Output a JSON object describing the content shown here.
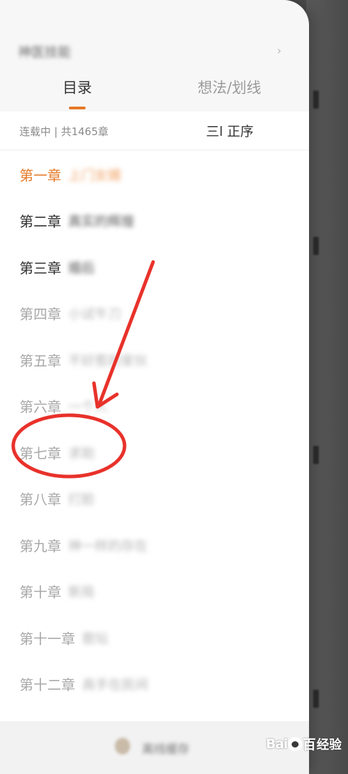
{
  "drawer": {
    "book_title": "神医技能",
    "tabs": [
      {
        "label": "目录",
        "active": true
      },
      {
        "label": "想法/划线",
        "active": false
      }
    ],
    "status_text": "连载中 | 共1465章",
    "sort_icon_glyph": "三l",
    "sort_label": "正序",
    "chapters": [
      {
        "num": "第一章",
        "title": "上门女婿",
        "state": "current"
      },
      {
        "num": "第二章",
        "title": "真实的辉煌",
        "state": "read"
      },
      {
        "num": "第三章",
        "title": "婚后",
        "state": "read"
      },
      {
        "num": "第四章",
        "title": "小试牛刀",
        "state": "unread"
      },
      {
        "num": "第五章",
        "title": "不好惹的家伙",
        "state": "unread"
      },
      {
        "num": "第六章",
        "title": "一个人",
        "state": "unread"
      },
      {
        "num": "第七章",
        "title": "求助",
        "state": "unread"
      },
      {
        "num": "第八章",
        "title": "打脸",
        "state": "unread"
      },
      {
        "num": "第九章",
        "title": "神一样的存在",
        "state": "unread"
      },
      {
        "num": "第十章",
        "title": "新局",
        "state": "unread"
      },
      {
        "num": "第十一章",
        "title": "歌坛",
        "state": "unread"
      },
      {
        "num": "第十二章",
        "title": "高手在民间",
        "state": "unread"
      }
    ],
    "bottom_label": "离线缓存"
  },
  "colors": {
    "accent": "#e57927",
    "annotation": "#e8322b"
  },
  "watermark": {
    "logo_left": "Bai",
    "logo_right": "百",
    "sub": "经验"
  }
}
